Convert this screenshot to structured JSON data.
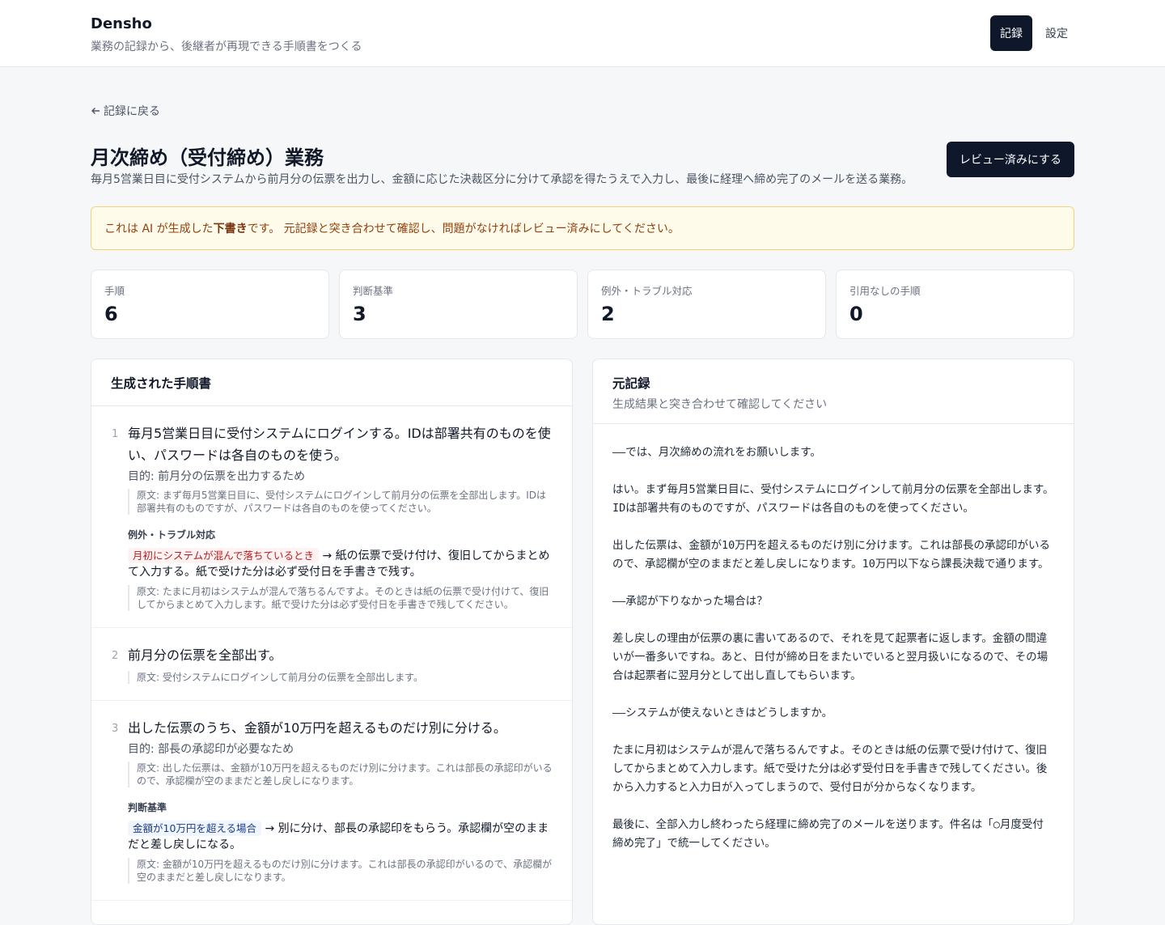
{
  "header": {
    "brand": "Densho",
    "tagline": "業務の記録から、後継者が再現できる手順書をつくる",
    "nav_records": "記録",
    "nav_settings": "設定"
  },
  "page": {
    "back": "記録に戻る",
    "title": "月次締め（受付締め）業務",
    "description": "毎月5営業日目に受付システムから前月分の伝票を出力し、金額に応じた決裁区分に分けて承認を得たうえで入力し、最後に経理へ締め完了のメールを送る業務。",
    "review_button": "レビュー済みにする"
  },
  "notice": {
    "pre": "これは AI が生成した",
    "bold": "下書き",
    "post": "です。 元記録と突き合わせて確認し、問題がなければレビュー済みにしてください。"
  },
  "stats": [
    {
      "label": "手順",
      "value": "6"
    },
    {
      "label": "判断基準",
      "value": "3"
    },
    {
      "label": "例外・トラブル対応",
      "value": "2"
    },
    {
      "label": "引用なしの手順",
      "value": "0"
    }
  ],
  "generated": {
    "title": "生成された手順書",
    "steps": [
      {
        "num": "1",
        "text": "毎月5営業日目に受付システムにログインする。IDは部署共有のものを使い、パスワードは各自のものを使う。",
        "purpose": "目的: 前月分の伝票を出力するため",
        "quote": "原文: まず毎月5営業日目に、受付システムにログインして前月分の伝票を全部出します。IDは部署共有のものですが、パスワードは各自のものを使ってください。",
        "section_title": "例外・トラブル対応",
        "condition": "月初にシステムが混んで落ちているとき",
        "action": "→ 紙の伝票で受け付け、復旧してからまとめて入力する。紙で受けた分は必ず受付日を手書きで残す。",
        "condition_quote": "原文: たまに月初はシステムが混んで落ちるんですよ。そのときは紙の伝票で受け付けて、復旧してからまとめて入力します。紙で受けた分は必ず受付日を手書きで残してください。"
      },
      {
        "num": "2",
        "text": "前月分の伝票を全部出す。",
        "quote": "原文: 受付システムにログインして前月分の伝票を全部出します。"
      },
      {
        "num": "3",
        "text": "出した伝票のうち、金額が10万円を超えるものだけ別に分ける。",
        "purpose": "目的: 部長の承認印が必要なため",
        "quote": "原文: 出した伝票は、金額が10万円を超えるものだけ別に分けます。これは部長の承認印がいるので、承認欄が空のままだと差し戻しになります。",
        "section_title": "判断基準",
        "condition": "金額が10万円を超える場合",
        "action": "→ 別に分け、部長の承認印をもらう。承認欄が空のままだと差し戻しになる。",
        "condition_quote": "原文: 金額が10万円を超えるものだけ別に分けます。これは部長の承認印がいるので、承認欄が空のままだと差し戻しになります。"
      }
    ]
  },
  "source": {
    "title": "元記録",
    "subtitle": "生成結果と突き合わせて確認してください",
    "paragraphs": [
      "——では、月次締めの流れをお願いします。",
      "はい。まず毎月5営業日目に、受付システムにログインして前月分の伝票を全部出します。IDは部署共有のものですが、パスワードは各自のものを使ってください。",
      "出した伝票は、金額が10万円を超えるものだけ別に分けます。これは部長の承認印がいるので、承認欄が空のままだと差し戻しになります。10万円以下なら課長決裁で通ります。",
      "——承認が下りなかった場合は？",
      "差し戻しの理由が伝票の裏に書いてあるので、それを見て起票者に返します。金額の間違いが一番多いですね。あと、日付が締め日をまたいでいると翌月扱いになるので、その場合は起票者に翌月分として出し直してもらいます。",
      "——システムが使えないときはどうしますか。",
      "たまに月初はシステムが混んで落ちるんですよ。そのときは紙の伝票で受け付けて、復旧してからまとめて入力します。紙で受けた分は必ず受付日を手書きで残してください。後から入力すると入力日が入ってしまうので、受付日が分からなくなります。",
      "最後に、全部入力し終わったら経理に締め完了のメールを送ります。件名は「○月度受付締め完了」で統一してください。"
    ]
  }
}
